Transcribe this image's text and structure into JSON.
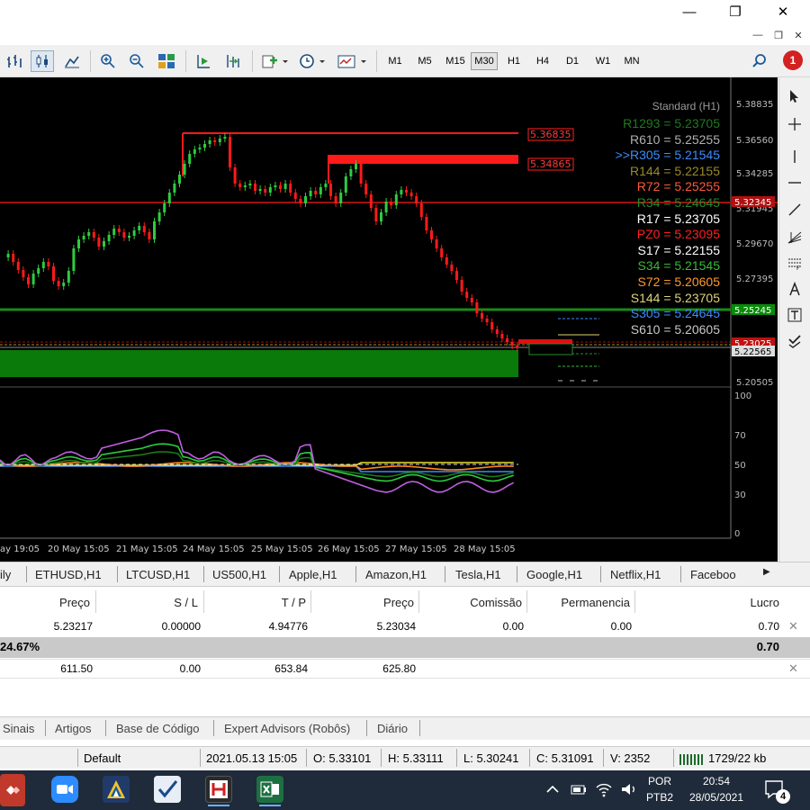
{
  "window": {
    "minimize": "—",
    "restore": "❐",
    "close": "✕"
  },
  "mdi": {
    "minimize": "—",
    "restore": "❐",
    "close": "✕"
  },
  "toolbar": {
    "timeframes": [
      "M1",
      "M5",
      "M15",
      "M30",
      "H1",
      "H4",
      "D1",
      "W1",
      "MN"
    ],
    "active_timeframe": "M30",
    "notifications_count": "1"
  },
  "chart": {
    "price_axis": [
      "5.38835",
      "5.36560",
      "5.34285",
      "5.31945",
      "5.29670",
      "5.27395",
      "5.25245",
      "5.22565",
      "5.20505"
    ],
    "time_axis": [
      "ay 19:05",
      "20 May 15:05",
      "21 May 15:05",
      "24 May 15:05",
      "25 May 15:05",
      "26 May 15:05",
      "27 May 15:05",
      "28 May 15:05"
    ],
    "osc_axis": [
      "100",
      "70",
      "50",
      "30",
      "0"
    ],
    "price_tags": [
      "5.36835",
      "5.34865"
    ],
    "axis_tags": [
      "5.32345",
      "5.25245",
      "5.23025",
      "5.22565"
    ],
    "pivot_title": "Standard (H1)",
    "pivots": [
      {
        "text": "R1293 = 5.23705",
        "color": "#1e7a1e"
      },
      {
        "text": "R610 = 5.25255",
        "color": "#b0b0b0"
      },
      {
        "text": ">>R305 = 5.21545",
        "color": "#3a8cff"
      },
      {
        "text": "R144 = 5.22155",
        "color": "#9a8a2a"
      },
      {
        "text": "R72 = 5.25255",
        "color": "#ff5a3a"
      },
      {
        "text": "R34 = 5.24645",
        "color": "#2a8a2a"
      },
      {
        "text": "R17 = 5.23705",
        "color": "#ffffff"
      },
      {
        "text": "PZ0 = 5.23095",
        "color": "#ff2020"
      },
      {
        "text": "S17 = 5.22155",
        "color": "#ffffff"
      },
      {
        "text": "S34 = 5.21545",
        "color": "#3ab83a"
      },
      {
        "text": "S72 = 5.20605",
        "color": "#ff9a2a"
      },
      {
        "text": "S144 = 5.23705",
        "color": "#e0d27a"
      },
      {
        "text": "S305 = 5.24645",
        "color": "#3a8cff"
      },
      {
        "text": "S610 = 5.20605",
        "color": "#c8c8c8"
      }
    ]
  },
  "symbol_tabs": [
    "ily",
    "ETHUSD,H1",
    "LTCUSD,H1",
    "US500,H1",
    "Apple,H1",
    "Amazon,H1",
    "Tesla,H1",
    "Google,H1",
    "Netflix,H1",
    "Faceboo"
  ],
  "trade_table": {
    "headers": [
      "Preço",
      "S / L",
      "T / P",
      "Preço",
      "Comissão",
      "Permanencia",
      "Lucro"
    ],
    "row1": [
      "5.23217",
      "0.00000",
      "4.94776",
      "5.23034",
      "0.00",
      "0.00",
      "0.70"
    ],
    "total": {
      "left": "24.67%",
      "right": "0.70"
    },
    "row3": [
      "611.50",
      "0.00",
      "653.84",
      "625.80"
    ]
  },
  "bottom_tabs": [
    "Sinais",
    "Artigos",
    "Base de Código",
    "Expert Advisors (Robôs)",
    "Diário"
  ],
  "status": {
    "profile": "Default",
    "datetime": "2021.05.13 15:05",
    "open": "O: 5.33101",
    "high": "H: 5.33111",
    "low": "L: 5.30241",
    "close": "C: 5.31091",
    "volume": "V: 2352",
    "traffic": "1729/22 kb"
  },
  "taskbar": {
    "lang1": "POR",
    "lang2": "PTB2",
    "time": "20:54",
    "date": "28/05/2021",
    "notif": "4"
  }
}
